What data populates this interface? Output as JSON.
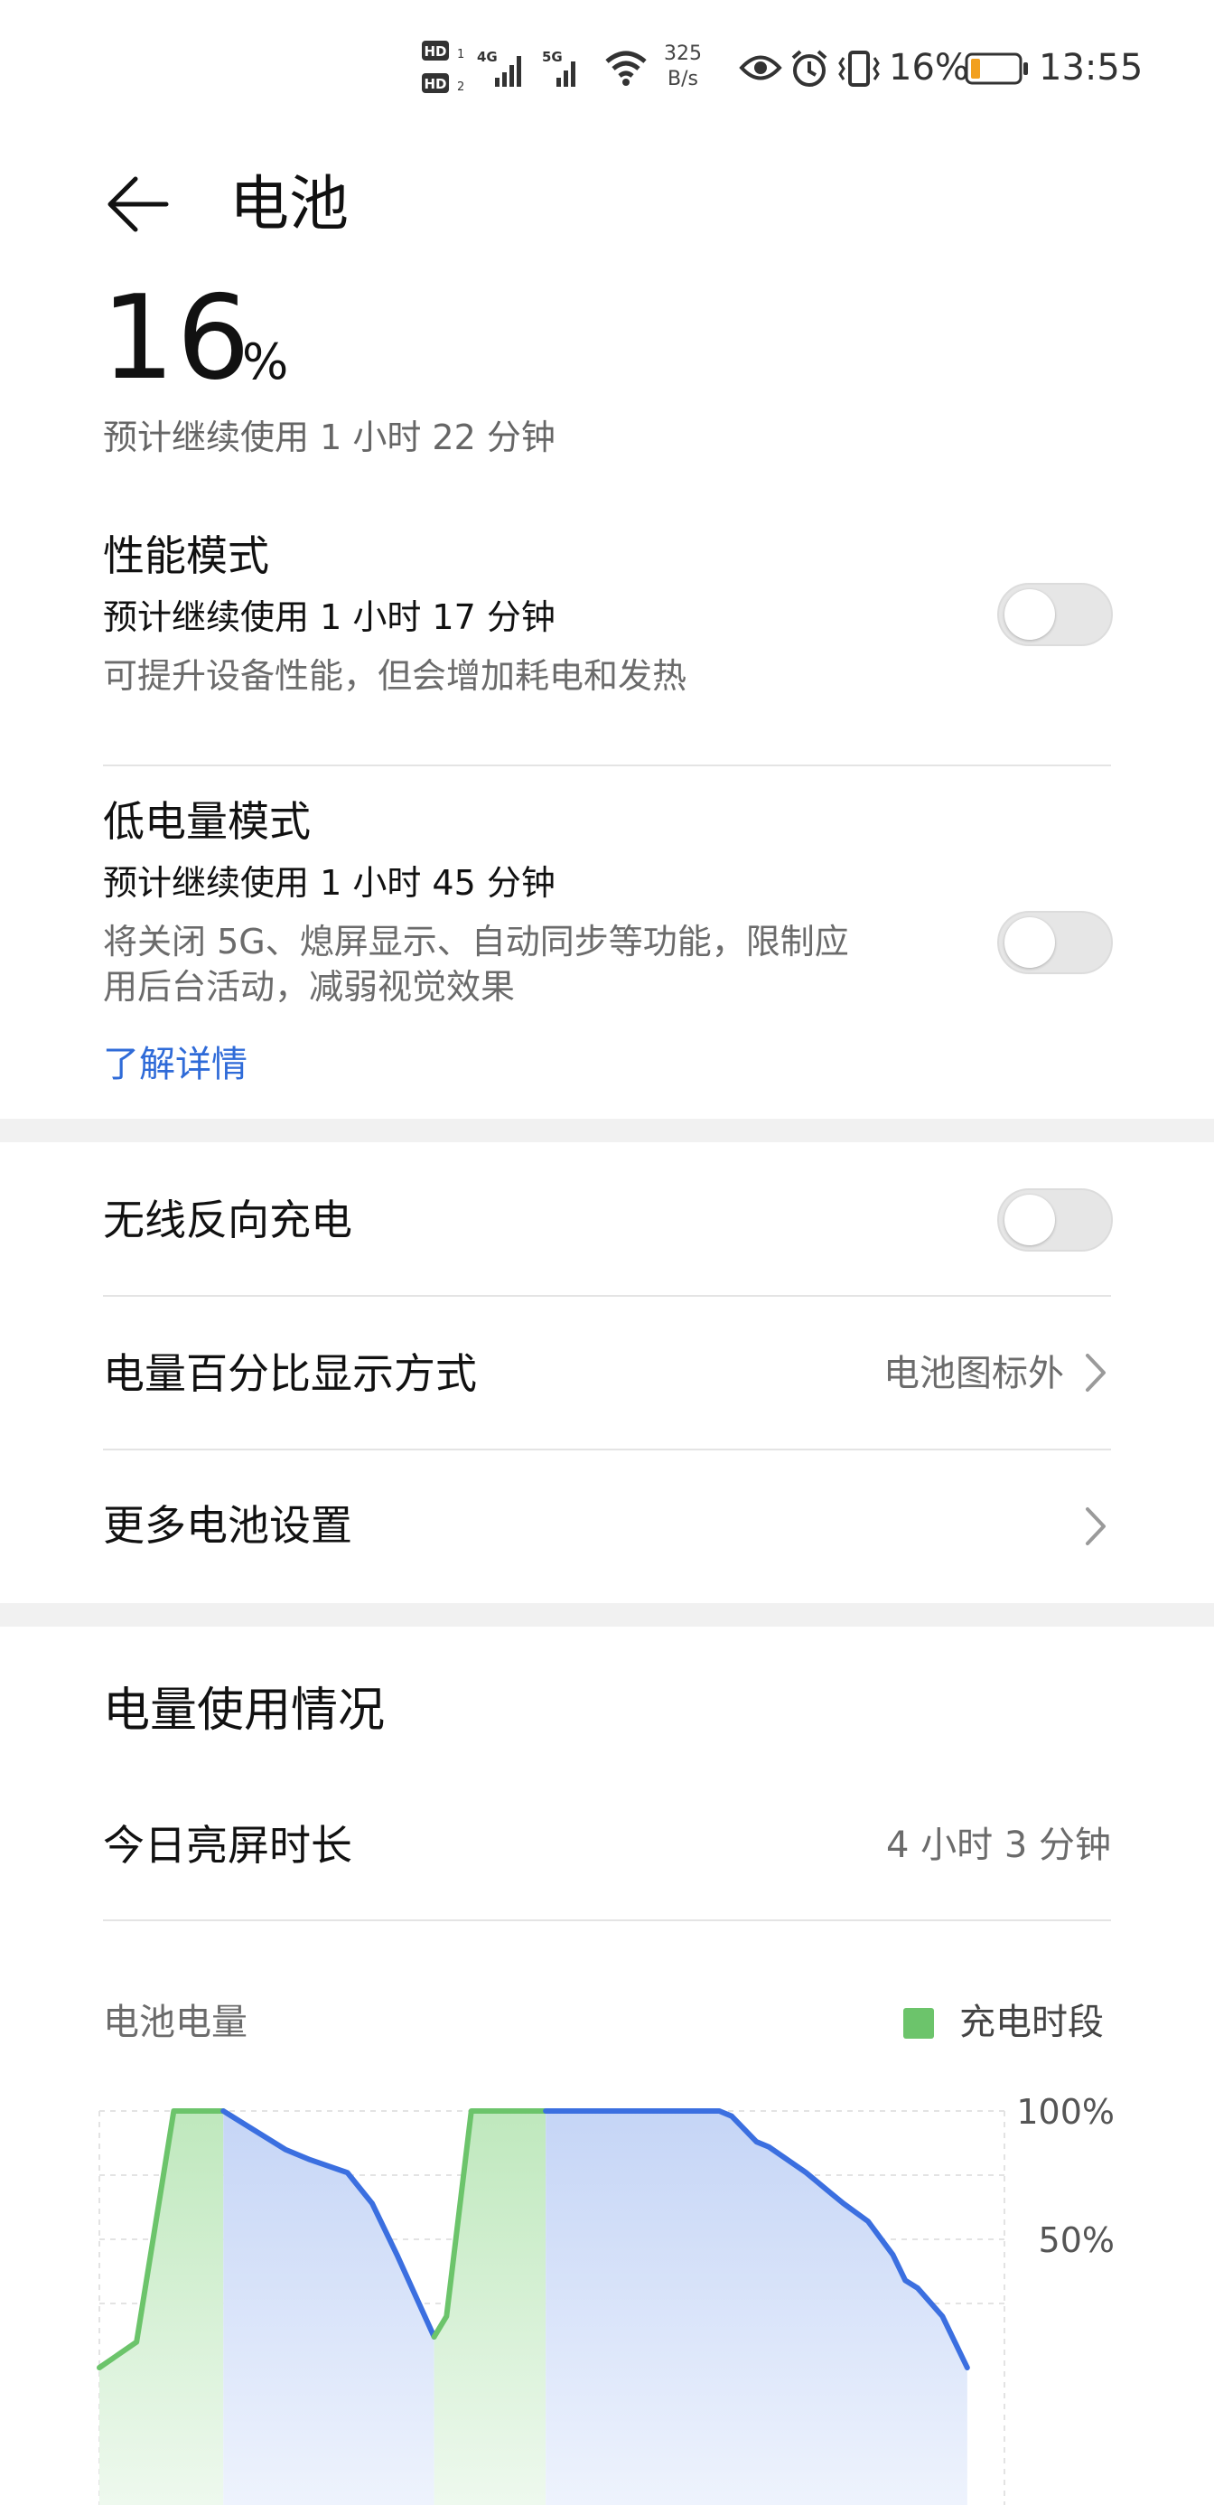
{
  "status_bar": {
    "hd1": "HD",
    "hd2": "HD",
    "net1": "4G",
    "net2": "5G",
    "speed_value": "325",
    "speed_unit": "B/s",
    "battery_percent": "16%",
    "time": "13:55",
    "icons": [
      "hd-icon",
      "signal-icon",
      "wifi-icon",
      "eye-icon",
      "alarm-icon",
      "vibrate-icon",
      "battery-icon"
    ]
  },
  "header": {
    "title": "电池",
    "back_icon": "back-arrow-icon"
  },
  "battery": {
    "level": "16",
    "unit": "%",
    "estimate": "预计继续使用 1 小时 22 分钟"
  },
  "modes": {
    "performance": {
      "title": "性能模式",
      "estimate": "预计继续使用 1 小时 17 分钟",
      "desc": "可提升设备性能，但会增加耗电和发热",
      "enabled": false
    },
    "low_power": {
      "title": "低电量模式",
      "estimate": "预计继续使用 1 小时 45 分钟",
      "desc_line1": "将关闭 5G、熄屏显示、自动同步等功能，限制应",
      "desc_line2": "用后台活动，减弱视觉效果",
      "link": "了解详情",
      "enabled": false
    }
  },
  "settings": {
    "wireless_reverse": {
      "title": "无线反向充电",
      "enabled": false
    },
    "percent_display": {
      "title": "电量百分比显示方式",
      "value": "电池图标外"
    },
    "more": {
      "title": "更多电池设置"
    }
  },
  "usage": {
    "section_title": "电量使用情况",
    "screen_time_label": "今日亮屏时长",
    "screen_time_value": "4 小时 3 分钟",
    "chart_label": "电池电量",
    "legend_charging": "充电时段"
  },
  "colors": {
    "accent_link": "#2f6bd8",
    "charging_green": "#6cc46b",
    "discharge_blue": "#3b6fe0"
  },
  "chart_data": {
    "type": "area",
    "title": "电池电量",
    "y_ticks": [
      "100%",
      "50%"
    ],
    "ylim": [
      0,
      100
    ],
    "legend": [
      "充电时段"
    ],
    "x": [
      0,
      3,
      6,
      8,
      10,
      12,
      15,
      17,
      20,
      22,
      24,
      27,
      28,
      30,
      32,
      36,
      41,
      50,
      51,
      53,
      54,
      57,
      58,
      59,
      60,
      62,
      64,
      65,
      66,
      68,
      70,
      71,
      72,
      73
    ],
    "values": [
      0,
      10,
      100,
      100,
      100,
      90,
      85,
      72,
      68,
      55,
      36,
      12,
      20,
      100,
      100,
      100,
      100,
      100,
      98,
      88,
      86,
      76,
      72,
      68,
      64,
      57,
      44,
      34,
      31,
      20,
      0,
      0,
      0,
      0
    ],
    "segments": [
      {
        "kind": "charging",
        "x": [
          0,
          3,
          6,
          8,
          10
        ],
        "values": [
          0,
          10,
          100,
          100,
          100
        ]
      },
      {
        "kind": "discharging",
        "x": [
          10,
          12,
          15,
          17,
          20,
          22,
          24,
          27
        ],
        "values": [
          100,
          94,
          85,
          81,
          76,
          64,
          44,
          12
        ]
      },
      {
        "kind": "charging",
        "x": [
          27,
          28,
          30,
          32,
          36
        ],
        "values": [
          12,
          20,
          100,
          100,
          100
        ]
      },
      {
        "kind": "discharging",
        "x": [
          36,
          41,
          50,
          51,
          53,
          54,
          57,
          58,
          59,
          60,
          62,
          64,
          65,
          66,
          68,
          70
        ],
        "values": [
          100,
          100,
          100,
          98,
          88,
          86,
          76,
          72,
          68,
          64,
          57,
          44,
          34,
          31,
          20,
          0
        ]
      }
    ]
  }
}
